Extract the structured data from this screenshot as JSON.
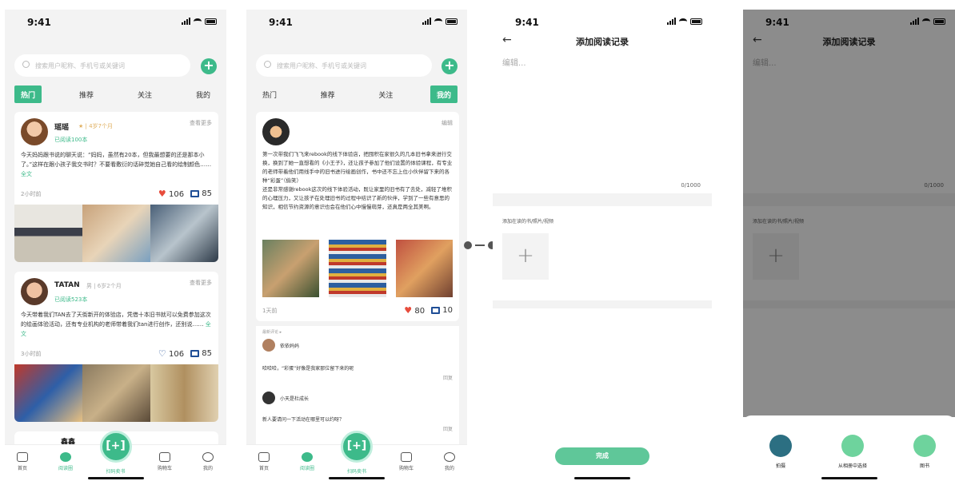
{
  "status": {
    "time": "9:41"
  },
  "feed": {
    "search_placeholder": "搜索用户昵称、手机号或关键词",
    "tabs": [
      "热门",
      "推荐",
      "关注",
      "我的"
    ],
    "posts": [
      {
        "name": "瑶瑶",
        "tag": "★ | 4岁7个月",
        "read": "已阅读100本",
        "see_more": "查看更多",
        "text": "今天妈妈跟书说的聊天说：“妈妈，虽然有20本，但我最想要的还是那本小了。”这样在跟小孩子我交书时？不要看敷衍的话碎觉她自己看的绘制颜色…… ",
        "full": "全文",
        "time": "2小时前",
        "likes": "106",
        "comments": "85"
      },
      {
        "name": "TATAN",
        "tag": "男 | 6岁2个月",
        "read": "已阅读523本",
        "see_more": "查看更多",
        "text": "今天带着我们TAN去了天街新开的体验店，凭借十本旧书就可以免费参加这次的绘画体验活动，还有专业机构的老师带着我们tan进行创作，还别说…… ",
        "full": "全文",
        "time": "3小时前",
        "likes": "106",
        "comments": "85"
      },
      {
        "name": "鑫鑫",
        "tag": "★ | ..."
      }
    ],
    "tabbar": [
      "首页",
      "阅读圈",
      "扫码卖书",
      "购物车",
      "我的"
    ]
  },
  "detail": {
    "tabs": [
      "热门",
      "推荐",
      "关注",
      "我的"
    ],
    "edit": "编辑",
    "text": "第一次带我们飞飞来rebook的线下体验店，把囤积在家很久的几本旧书拿来进行交换，换到了她一直想看的《小王子》，还让孩子参加了他们设置的体验课程，有专业的老师带着他们用线手中的旧书进行绘画创作，书中还不忘上位小伙伴留下来的各种“彩蛋”（偷笑）\n还是非常感谢rebook这次的线下体验活动，既让家里的旧书有了去处，减轻了堆积的心理压力，又让孩子在处理旧书的过程中结识了新的伙伴，学到了一些有意思的知识，相信节约资源的意识也会在他们心中慢慢萌芽，还真是两全其美啊。",
    "time": "1天前",
    "likes": "80",
    "comments": "10",
    "comments_header": "最新评论 ▸",
    "c1_name": "依依妈妈",
    "c1_text": "哈哈哈，“彩蛋”好像是我家那位留下来的呢",
    "c1_reply": "回复",
    "c2_name": "小天是杜成长",
    "c2_text": "新人要请问一下活动在哪里可以约呀？",
    "c2_reply": "回复"
  },
  "add": {
    "title": "添加阅读记录",
    "placeholder": "编辑...",
    "counter": "0/1000",
    "add_label": "添加在读的书/照片/视频",
    "done": "完成"
  },
  "sheet": {
    "options": [
      "拍摄",
      "从相册中选择",
      "图书"
    ]
  },
  "colors": {
    "accent": "#3dba8a"
  }
}
